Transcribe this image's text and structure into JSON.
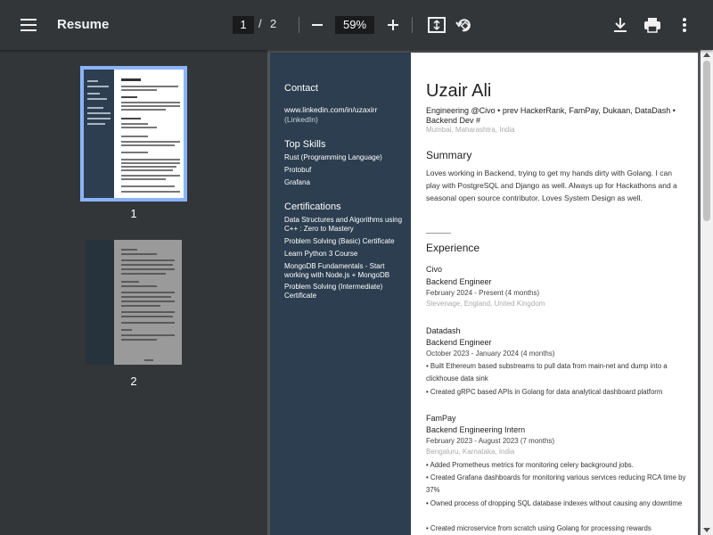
{
  "toolbar": {
    "title": "Resume",
    "current_page": "1",
    "page_separator": "/",
    "total_pages": "2",
    "zoom": "59%",
    "icons": [
      "menu-icon",
      "zoom-out-icon",
      "zoom-in-icon",
      "fit-page-icon",
      "rotate-icon",
      "download-icon",
      "print-icon",
      "more-vert-icon"
    ]
  },
  "sidebar": {
    "thumbnails": [
      {
        "label": "1",
        "selected": true
      },
      {
        "label": "2",
        "selected": false
      }
    ]
  },
  "resume": {
    "contact_heading": "Contact",
    "linkedin_url": "www.linkedin.com/in/uzaxirr",
    "linkedin_label": "(LinkedIn)",
    "skills_heading": "Top Skills",
    "skills": [
      "Rust (Programming Language)",
      "Protobuf",
      "Grafana"
    ],
    "certs_heading": "Certifications",
    "certs": [
      "Data Structures and Algorithms using C++ : Zero to Mastery",
      "Problem Solving (Basic) Certificate",
      "Learn Python 3 Course",
      "MongoDB Fundamentals - Start working with Node.js + MongoDB",
      "Problem Solving (Intermediate) Certificate"
    ],
    "name": "Uzair Ali",
    "headline": "Engineering @Civo • prev HackerRank, FamPay, Dukaan, DataDash • Backend Dev #",
    "location": "Mumbai, Maharashtra, India",
    "summary_heading": "Summary",
    "summary": "Loves working in Backend, trying to get my hands dirty with Golang. I can play with PostgreSQL and Django as well. Always up for Hackathons and a seasonal open source contributor. Loves System Design as well.",
    "experience_heading": "Experience",
    "experience": [
      {
        "company": "Civo",
        "role": "Backend Engineer",
        "dates": "February 2024 - Present (4 months)",
        "location": "Stevenage, England, United Kingdom",
        "bullets": []
      },
      {
        "company": "Datadash",
        "role": "Backend Engineer",
        "dates": "October 2023 - January 2024 (4 months)",
        "location": "",
        "bullets": [
          "• Built Ethereum based substreams to pull data from main-net and dump into a clickhouse data sink",
          "• Created gRPC based APIs in Golang for data analytical dashboard platform"
        ]
      },
      {
        "company": "FamPay",
        "role": "Backend Engineering Intern",
        "dates": "February 2023 - August 2023 (7 months)",
        "location": "Bengaluru, Karnataka, India",
        "bullets": [
          "• Added Prometheus metrics for monitoring celery background jobs.",
          "• Created Grafana dashboards for monitoring various services reducing RCA time by 37%",
          "• Owned process of dropping SQL database indexes without causing any downtime",
          "• Created microservice from scratch using Golang for processing rewards"
        ]
      }
    ]
  }
}
